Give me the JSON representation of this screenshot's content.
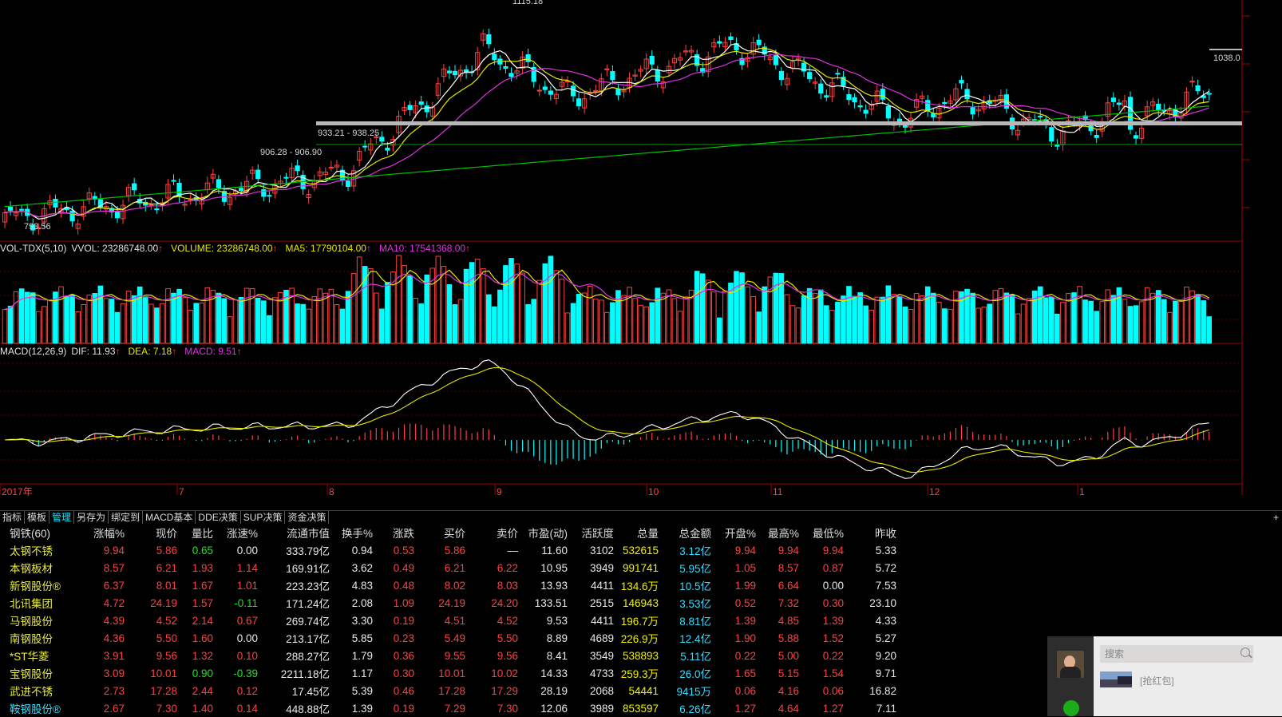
{
  "colors": {
    "up": "#ff4040",
    "down": "#00ffff",
    "ma1": "#ffffff",
    "ma2": "#e6e600",
    "ma3": "#e030e0",
    "ma4": "#00c000",
    "grid": "#8b0000"
  },
  "price_chart": {
    "peak_label": "1115.18",
    "low_label": "793.56",
    "last_label": "1038.0",
    "range_label_1": "933.21 - 938.25",
    "range_label_2": "906.28 - 906.90"
  },
  "volume_indicator": {
    "name": "VOL-TDX(5,10)",
    "vvol": "VVOL: 23286748.00",
    "volume": "VOLUME: 23286748.00",
    "ma5": "MA5: 17790104.00",
    "ma10": "MA10: 17541368.00"
  },
  "macd_indicator": {
    "name": "MACD(12,26,9)",
    "dif": "DIF: 11.93",
    "dea": "DEA: 7.18",
    "macd": "MACD: 9.51"
  },
  "time_axis": [
    "2017年",
    "7",
    "8",
    "9",
    "10",
    "11",
    "12",
    "2017",
    "1"
  ],
  "tabs": [
    "指标",
    "模板",
    "管理",
    "另存为",
    "绑定到",
    "MACD基本",
    "DDE决策",
    "SUP决策",
    "资金决策"
  ],
  "tab_plus": "+",
  "table": {
    "headers": [
      "钢铁(60)",
      "涨幅%",
      "现价",
      "量比",
      "涨速%",
      "流通市值",
      "换手%",
      "涨跌",
      "买价",
      "卖价",
      "市盈(动)",
      "活跃度",
      "总量",
      "总金额",
      "开盘%",
      "最高%",
      "最低%",
      "昨收"
    ],
    "rows": [
      [
        "太钢不锈",
        "9.94",
        "5.86",
        "0.65",
        "0.00",
        "333.79亿",
        "0.94",
        "0.53",
        "5.86",
        "—",
        "11.60",
        "3102",
        "532615",
        "3.12亿",
        "9.94",
        "9.94",
        "9.94",
        "5.33"
      ],
      [
        "本钢板材",
        "8.57",
        "6.21",
        "1.93",
        "1.14",
        "169.91亿",
        "3.62",
        "0.49",
        "6.21",
        "6.22",
        "10.95",
        "3949",
        "991741",
        "5.95亿",
        "1.05",
        "8.57",
        "0.87",
        "5.72"
      ],
      [
        "新钢股份®",
        "6.37",
        "8.01",
        "1.67",
        "1.01",
        "223.23亿",
        "4.83",
        "0.48",
        "8.02",
        "8.03",
        "13.93",
        "4411",
        "134.6万",
        "10.5亿",
        "1.99",
        "6.64",
        "0.00",
        "7.53"
      ],
      [
        "北讯集团",
        "4.72",
        "24.19",
        "1.57",
        "-0.11",
        "171.24亿",
        "2.08",
        "1.09",
        "24.19",
        "24.20",
        "133.51",
        "2515",
        "146943",
        "3.53亿",
        "0.52",
        "7.32",
        "0.30",
        "23.10"
      ],
      [
        "马钢股份",
        "4.39",
        "4.52",
        "2.14",
        "0.67",
        "269.74亿",
        "3.30",
        "0.19",
        "4.51",
        "4.52",
        "9.53",
        "4411",
        "196.7万",
        "8.81亿",
        "1.39",
        "4.85",
        "1.39",
        "4.33"
      ],
      [
        "南钢股份",
        "4.36",
        "5.50",
        "1.60",
        "0.00",
        "213.17亿",
        "5.85",
        "0.23",
        "5.49",
        "5.50",
        "8.89",
        "4689",
        "226.9万",
        "12.4亿",
        "1.90",
        "5.88",
        "1.52",
        "5.27"
      ],
      [
        "*ST华菱",
        "3.91",
        "9.56",
        "1.32",
        "0.10",
        "288.27亿",
        "1.79",
        "0.36",
        "9.55",
        "9.56",
        "8.41",
        "3549",
        "538893",
        "5.11亿",
        "0.22",
        "5.00",
        "0.22",
        "9.20"
      ],
      [
        "宝钢股份",
        "3.09",
        "10.01",
        "0.90",
        "-0.39",
        "2211.18亿",
        "1.17",
        "0.30",
        "10.01",
        "10.02",
        "14.33",
        "4733",
        "259.3万",
        "26.0亿",
        "1.65",
        "5.15",
        "1.54",
        "9.71"
      ],
      [
        "武进不锈",
        "2.73",
        "17.28",
        "2.44",
        "0.12",
        "17.45亿",
        "5.39",
        "0.46",
        "17.28",
        "17.29",
        "28.19",
        "2068",
        "54441",
        "9415万",
        "0.06",
        "4.16",
        "0.06",
        "16.82"
      ],
      [
        "鞍钢股份®",
        "2.67",
        "7.30",
        "1.40",
        "0.14",
        "448.88亿",
        "1.39",
        "0.19",
        "7.29",
        "7.30",
        "12.06",
        "3989",
        "853597",
        "6.26亿",
        "1.27",
        "4.64",
        "1.27",
        "7.11"
      ]
    ]
  },
  "chat": {
    "search_placeholder": "搜索",
    "message": "[抢红包]"
  }
}
